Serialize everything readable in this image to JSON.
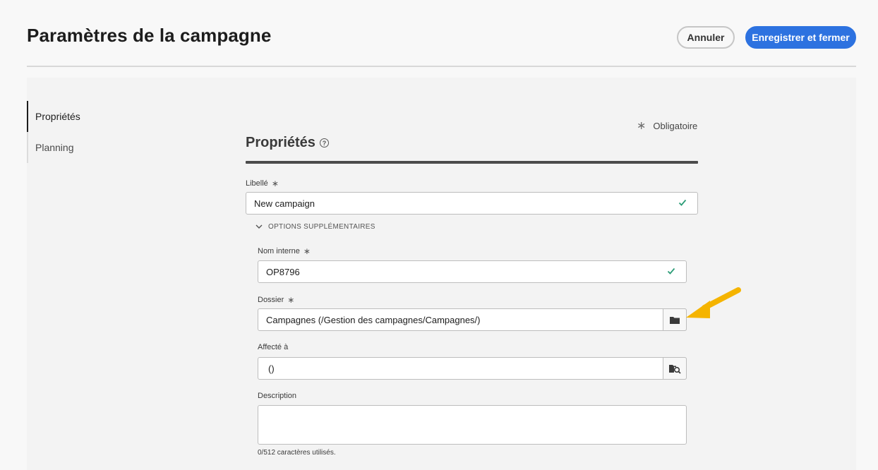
{
  "header": {
    "title": "Paramètres de la campagne",
    "cancel_label": "Annuler",
    "save_label": "Enregistrer et fermer"
  },
  "sidenav": {
    "items": [
      {
        "label": "Propriétés",
        "active": true
      },
      {
        "label": "Planning",
        "active": false
      }
    ]
  },
  "form": {
    "required_legend": "Obligatoire",
    "section_title": "Propriétés",
    "libelle": {
      "label": "Libellé",
      "value": "New campaign"
    },
    "options_toggle": "OPTIONS SUPPLÉMENTAIRES",
    "nom_interne": {
      "label": "Nom interne",
      "value": "OP8796"
    },
    "dossier": {
      "label": "Dossier",
      "value": "Campagnes (/Gestion des campagnes/Campagnes/)"
    },
    "affecte": {
      "label": "Affecté à",
      "value": "()"
    },
    "description": {
      "label": "Description",
      "value": "",
      "char_count": "0/512 caractères utilisés."
    }
  },
  "colors": {
    "accent": "#2d72e0",
    "valid": "#2d9d78",
    "annotation_arrow": "#f5b400"
  },
  "icons": [
    "help-icon",
    "check-icon",
    "chevron-down-icon",
    "folder-icon",
    "folder-search-icon",
    "arrow-annotation"
  ]
}
